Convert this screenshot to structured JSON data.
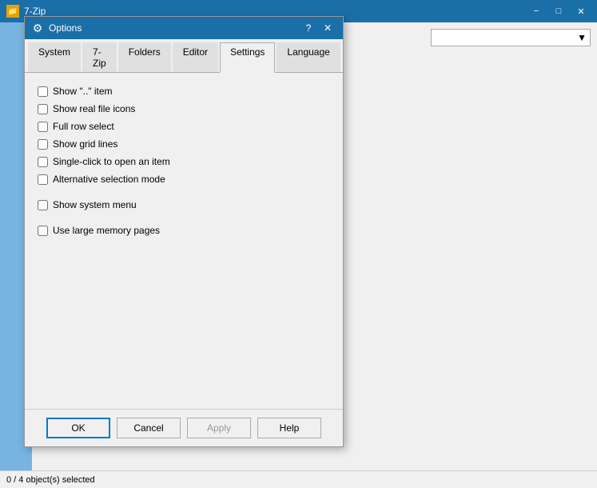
{
  "background": {
    "titlebar": {
      "icon": "📁",
      "title": "7-Zip",
      "min_btn": "−",
      "max_btn": "□",
      "close_btn": "✕"
    },
    "statusbar": {
      "text": "0 / 4 object(s) selected"
    }
  },
  "dialog": {
    "titlebar": {
      "icon": "⚙",
      "title": "Options",
      "help_btn": "?",
      "close_btn": "✕"
    },
    "tabs": [
      {
        "id": "system",
        "label": "System"
      },
      {
        "id": "7zip",
        "label": "7-Zip"
      },
      {
        "id": "folders",
        "label": "Folders"
      },
      {
        "id": "editor",
        "label": "Editor"
      },
      {
        "id": "settings",
        "label": "Settings",
        "active": true
      },
      {
        "id": "language",
        "label": "Language"
      }
    ],
    "settings": {
      "checkboxes": [
        {
          "id": "show-item",
          "label": "Show \"..\" item",
          "checked": false
        },
        {
          "id": "show-real-icons",
          "label": "Show real file icons",
          "checked": false
        },
        {
          "id": "full-row-select",
          "label": "Full row select",
          "checked": false
        },
        {
          "id": "show-grid-lines",
          "label": "Show grid lines",
          "checked": false
        },
        {
          "id": "single-click",
          "label": "Single-click to open an item",
          "checked": false
        },
        {
          "id": "alt-selection",
          "label": "Alternative selection mode",
          "checked": false
        }
      ],
      "checkboxes2": [
        {
          "id": "show-system-menu",
          "label": "Show system menu",
          "checked": false
        }
      ],
      "checkboxes3": [
        {
          "id": "large-memory",
          "label": "Use large memory pages",
          "checked": false
        }
      ]
    },
    "buttons": {
      "ok": "OK",
      "cancel": "Cancel",
      "apply": "Apply",
      "help": "Help"
    }
  }
}
